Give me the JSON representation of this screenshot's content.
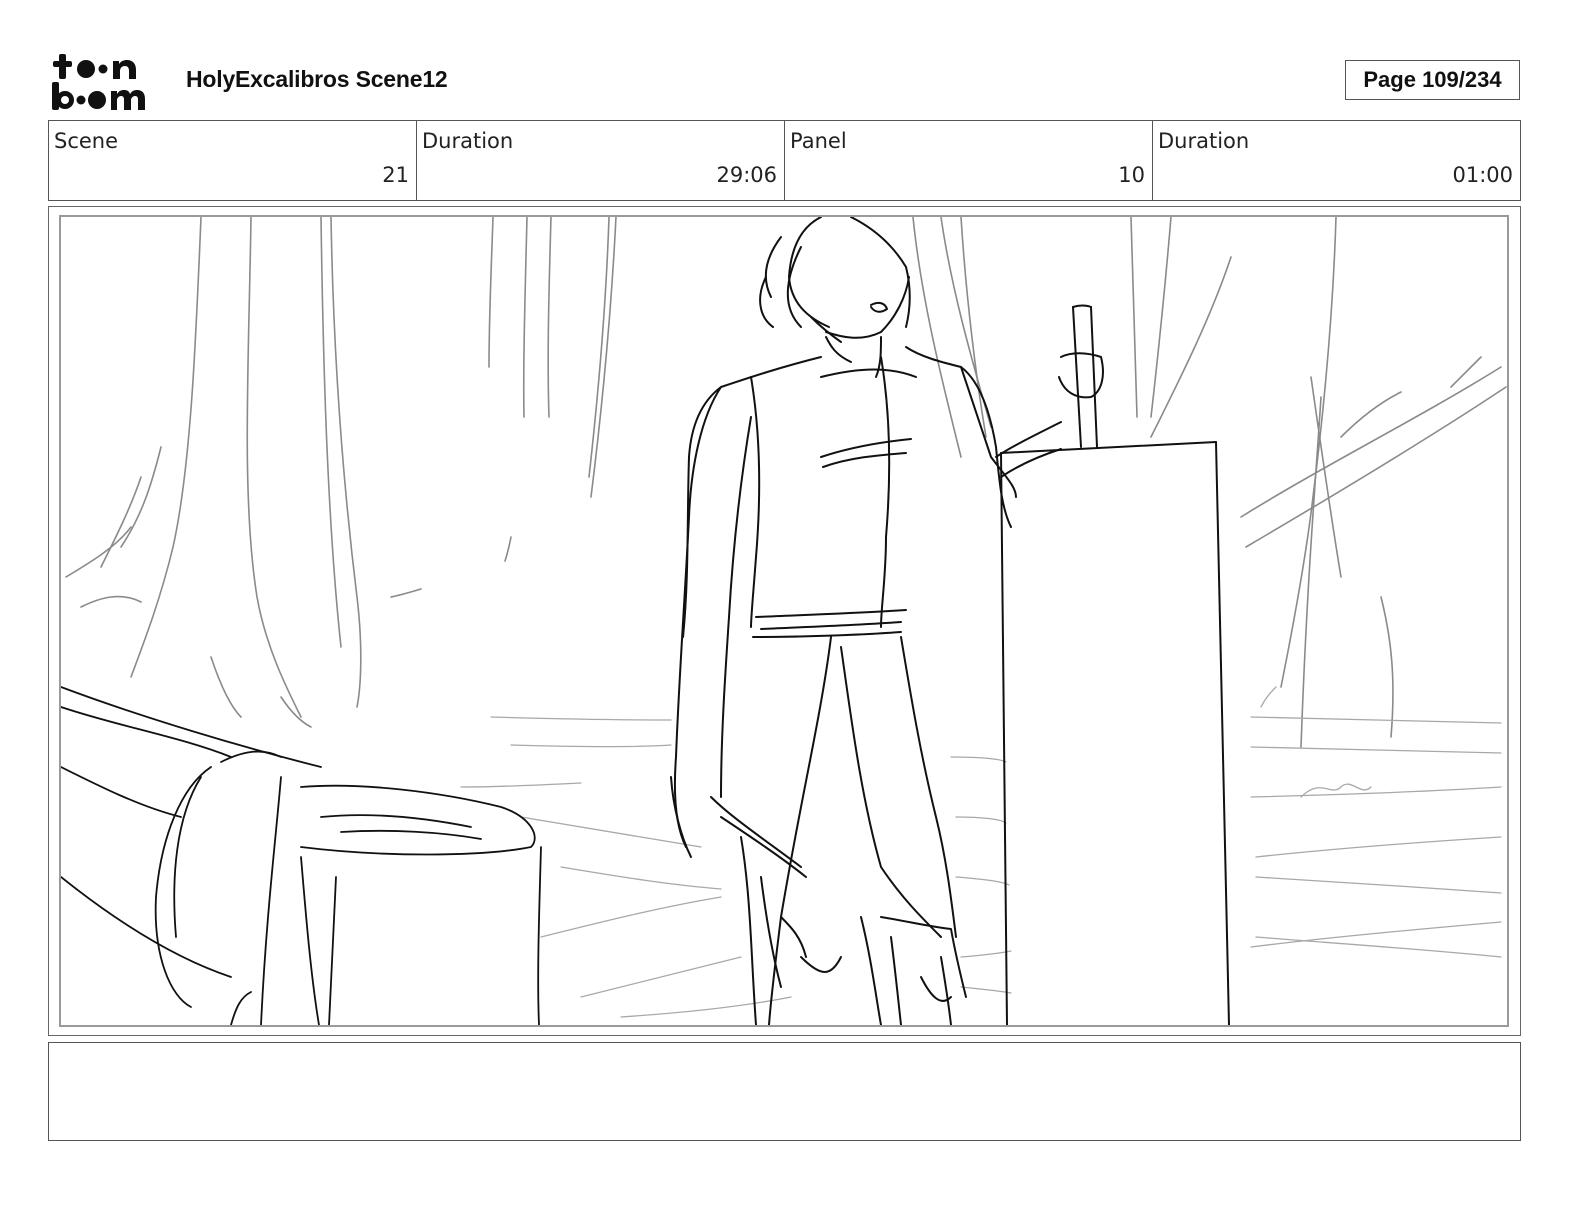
{
  "header": {
    "logo_text": "toon boom",
    "title": "HolyExcalibros Scene12",
    "page": "Page 109/234"
  },
  "info": [
    {
      "label": "Scene",
      "value": "21"
    },
    {
      "label": "Duration",
      "value": "29:06"
    },
    {
      "label": "Panel",
      "value": "10"
    },
    {
      "label": "Duration",
      "value": "01:00"
    }
  ],
  "notes": {
    "text": ""
  }
}
